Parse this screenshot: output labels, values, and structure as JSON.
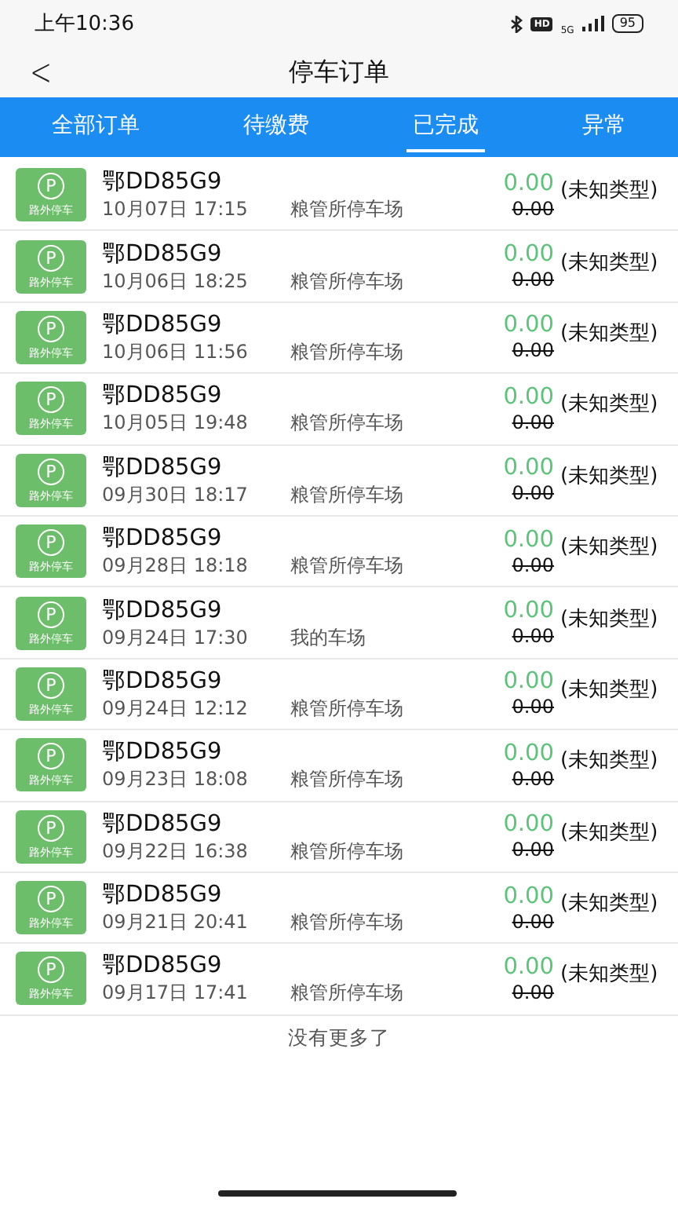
{
  "status_bar": {
    "time": "上午10:36",
    "hd": "HD",
    "network": "5G",
    "battery": "95"
  },
  "header": {
    "back": "<",
    "title": "停车订单"
  },
  "tabs": [
    {
      "label": "全部订单",
      "selected": false
    },
    {
      "label": "待缴费",
      "selected": false
    },
    {
      "label": "已完成",
      "selected": true
    },
    {
      "label": "异常",
      "selected": false
    }
  ],
  "orders": [
    {
      "badge_letter": "P",
      "badge_label": "路外停车",
      "plate": "鄂DD85G9",
      "time": "10月07日 17:15",
      "lot": "粮管所停车场",
      "paid": "0.00",
      "original": "0.00",
      "type": "(未知类型)"
    },
    {
      "badge_letter": "P",
      "badge_label": "路外停车",
      "plate": "鄂DD85G9",
      "time": "10月06日 18:25",
      "lot": "粮管所停车场",
      "paid": "0.00",
      "original": "0.00",
      "type": "(未知类型)"
    },
    {
      "badge_letter": "P",
      "badge_label": "路外停车",
      "plate": "鄂DD85G9",
      "time": "10月06日 11:56",
      "lot": "粮管所停车场",
      "paid": "0.00",
      "original": "0.00",
      "type": "(未知类型)"
    },
    {
      "badge_letter": "P",
      "badge_label": "路外停车",
      "plate": "鄂DD85G9",
      "time": "10月05日 19:48",
      "lot": "粮管所停车场",
      "paid": "0.00",
      "original": "0.00",
      "type": "(未知类型)"
    },
    {
      "badge_letter": "P",
      "badge_label": "路外停车",
      "plate": "鄂DD85G9",
      "time": "09月30日 18:17",
      "lot": "粮管所停车场",
      "paid": "0.00",
      "original": "0.00",
      "type": "(未知类型)"
    },
    {
      "badge_letter": "P",
      "badge_label": "路外停车",
      "plate": "鄂DD85G9",
      "time": "09月28日 18:18",
      "lot": "粮管所停车场",
      "paid": "0.00",
      "original": "0.00",
      "type": "(未知类型)"
    },
    {
      "badge_letter": "P",
      "badge_label": "路外停车",
      "plate": "鄂DD85G9",
      "time": "09月24日 17:30",
      "lot": "我的车场",
      "paid": "0.00",
      "original": "0.00",
      "type": "(未知类型)"
    },
    {
      "badge_letter": "P",
      "badge_label": "路外停车",
      "plate": "鄂DD85G9",
      "time": "09月24日 12:12",
      "lot": "粮管所停车场",
      "paid": "0.00",
      "original": "0.00",
      "type": "(未知类型)"
    },
    {
      "badge_letter": "P",
      "badge_label": "路外停车",
      "plate": "鄂DD85G9",
      "time": "09月23日 18:08",
      "lot": "粮管所停车场",
      "paid": "0.00",
      "original": "0.00",
      "type": "(未知类型)"
    },
    {
      "badge_letter": "P",
      "badge_label": "路外停车",
      "plate": "鄂DD85G9",
      "time": "09月22日 16:38",
      "lot": "粮管所停车场",
      "paid": "0.00",
      "original": "0.00",
      "type": "(未知类型)"
    },
    {
      "badge_letter": "P",
      "badge_label": "路外停车",
      "plate": "鄂DD85G9",
      "time": "09月21日 20:41",
      "lot": "粮管所停车场",
      "paid": "0.00",
      "original": "0.00",
      "type": "(未知类型)"
    },
    {
      "badge_letter": "P",
      "badge_label": "路外停车",
      "plate": "鄂DD85G9",
      "time": "09月17日 17:41",
      "lot": "粮管所停车场",
      "paid": "0.00",
      "original": "0.00",
      "type": "(未知类型)"
    }
  ],
  "footer": "没有更多了"
}
